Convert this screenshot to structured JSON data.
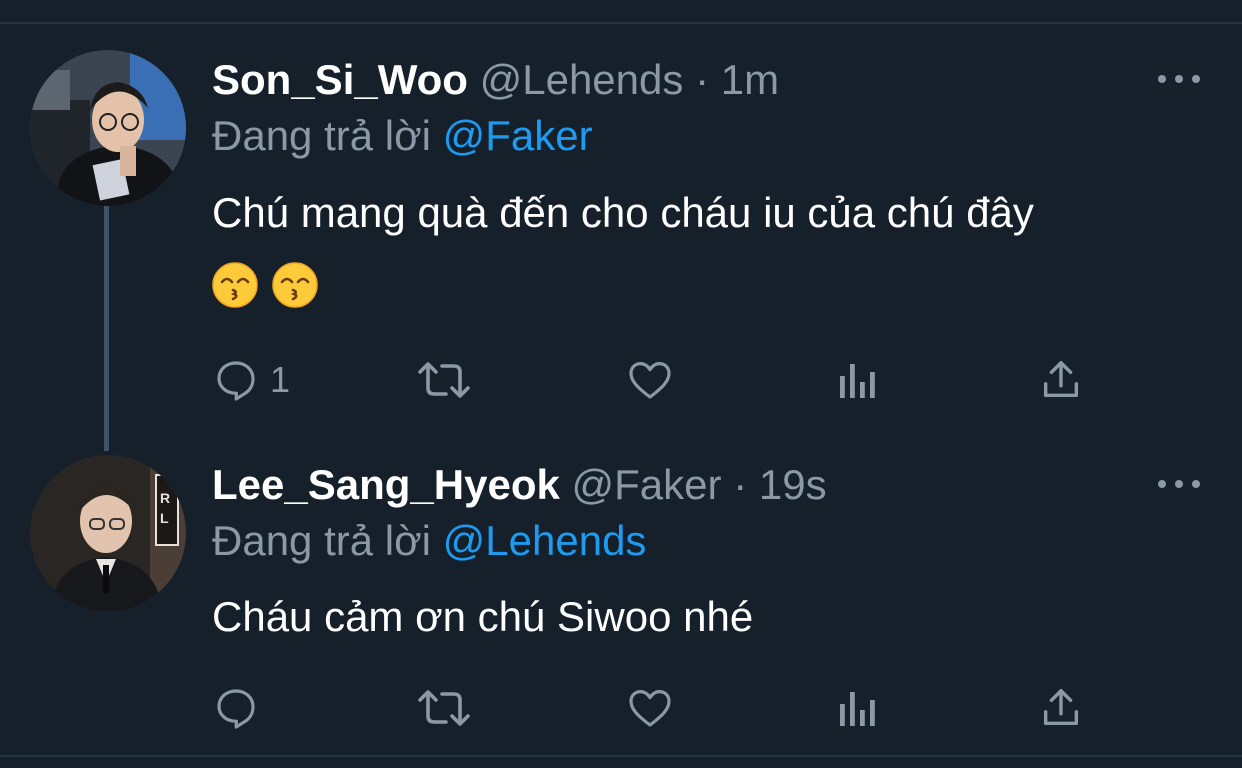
{
  "tweets": [
    {
      "display_name": "Son_Si_Woo",
      "handle": "@Lehends",
      "separator": "·",
      "time": "1m",
      "replying_to_label": "Đang trả lời",
      "replying_to_mention": "@Faker",
      "text": "Chú mang quà đến cho cháu iu của chú đây",
      "emojis": [
        "kissing-face-smiling-eyes-icon",
        "kissing-face-smiling-eyes-icon"
      ],
      "reply_count": "1",
      "retweet_count": "",
      "like_count": ""
    },
    {
      "display_name": "Lee_Sang_Hyeok",
      "handle": "@Faker",
      "separator": "·",
      "time": "19s",
      "replying_to_label": "Đang trả lời",
      "replying_to_mention": "@Lehends",
      "text": "Cháu cảm ơn chú Siwoo nhé",
      "reply_count": "",
      "retweet_count": "",
      "like_count": ""
    }
  ],
  "icons": {
    "reply": "reply-icon",
    "retweet": "retweet-icon",
    "like": "heart-icon",
    "analytics": "analytics-icon",
    "share": "share-icon",
    "more": "more-icon"
  },
  "colors": {
    "background": "#15202b",
    "text_primary": "#ffffff",
    "text_secondary": "#8b98a5",
    "accent": "#1d9bf0",
    "thread_line": "#3d5466"
  }
}
